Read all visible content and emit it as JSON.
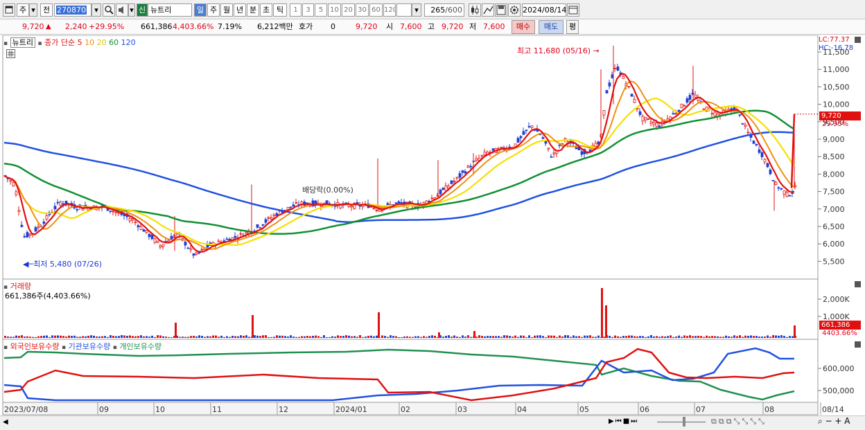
{
  "toolbar": {
    "period_main": "주",
    "prefix": "전",
    "code": "270870",
    "new_badge": "신",
    "stock_name": "뉴트리",
    "periods": [
      "일",
      "주",
      "월",
      "년",
      "분",
      "초",
      "틱"
    ],
    "intervals": [
      "1",
      "3",
      "5",
      "10",
      "20",
      "30",
      "60",
      "120"
    ],
    "count": "265",
    "count_total": "/600",
    "date": "2024/08/14"
  },
  "info": {
    "price": "9,720",
    "change": "2,240",
    "change_pct": "+29.95%",
    "volume": "661,386",
    "volume_pct": "4,403.66%",
    "turnover": "7.19%",
    "amount": "6,212백만",
    "quote_label": "호가",
    "quote_val": "0",
    "quote_price": "9,720",
    "open_label": "시",
    "open": "7,600",
    "high_label": "고",
    "high": "9,720",
    "low_label": "저",
    "low": "7,600",
    "buy_button": "매수",
    "sell_button": "매도",
    "eval_button": "평"
  },
  "price_panel": {
    "name_tag": "뉴트리",
    "ma_label": "종가 단순",
    "ma_periods": [
      "5",
      "10",
      "20",
      "60",
      "120"
    ],
    "ma_colors": [
      "#e01010",
      "#f09010",
      "#f5e000",
      "#109030",
      "#2050e0"
    ],
    "lc": "LC:77.37",
    "hc": "HC:-16.78",
    "high_note": "최고 11,680 (05/16)",
    "low_note": "최저 5,480 (07/26)",
    "dividend_note": "배당락(0.00%)",
    "current_price_tag": "9,720",
    "current_pct_tag": "29.95%",
    "y_ticks": [
      "11,500",
      "11,000",
      "10,500",
      "10,000",
      "9,500",
      "9,000",
      "8,500",
      "8,000",
      "7,500",
      "7,000",
      "6,500",
      "6,000",
      "5,500"
    ]
  },
  "volume_panel": {
    "title": "거래량",
    "value_text": "661,386주(4,403.66%)",
    "y_ticks": [
      "2,000K",
      "1,000K"
    ],
    "tag_value": "661,386",
    "tag_pct": "4403.66%"
  },
  "holding_panel": {
    "series_names": [
      "외국인보유수량",
      "기관보유수량",
      "개인보유수량"
    ],
    "series_colors": [
      "#e01010",
      "#2050e0",
      "#209050"
    ],
    "y_ticks": [
      "600,000",
      "500,000"
    ]
  },
  "x_axis": {
    "labels": [
      "2023/07/08",
      "09",
      "10",
      "11",
      "12",
      "2024/01",
      "02",
      "03",
      "04",
      "05",
      "06",
      "07",
      "08",
      "08/14"
    ]
  },
  "chart_data": {
    "type": "line",
    "description_units": "KRW price, daily candles with moving averages",
    "last_close": 9720,
    "period_high": 11680,
    "period_low": 5480,
    "ylim": [
      5200,
      11800
    ]
  }
}
